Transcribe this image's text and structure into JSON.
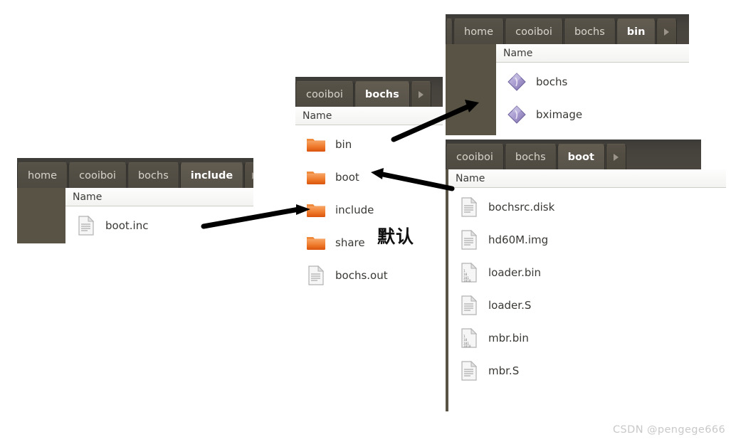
{
  "windows": [
    {
      "id": "include-window",
      "breadcrumbs": [
        {
          "label": "home",
          "active": false
        },
        {
          "label": "cooiboi",
          "active": false
        },
        {
          "label": "bochs",
          "active": false
        },
        {
          "label": "include",
          "active": true
        }
      ],
      "column_header": "Name",
      "items": [
        {
          "name": "boot.inc",
          "icon": "text-file-icon"
        }
      ]
    },
    {
      "id": "bochs-window",
      "leading_stub": true,
      "breadcrumbs": [
        {
          "label": "cooiboi",
          "active": false
        },
        {
          "label": "bochs",
          "active": true
        }
      ],
      "column_header": "Name",
      "items": [
        {
          "name": "bin",
          "icon": "folder-icon"
        },
        {
          "name": "boot",
          "icon": "folder-icon"
        },
        {
          "name": "include",
          "icon": "folder-icon"
        },
        {
          "name": "share",
          "icon": "folder-icon"
        },
        {
          "name": "bochs.out",
          "icon": "text-file-icon"
        }
      ]
    },
    {
      "id": "bin-window",
      "leading_stub": true,
      "breadcrumbs": [
        {
          "label": "home",
          "active": false
        },
        {
          "label": "cooiboi",
          "active": false
        },
        {
          "label": "bochs",
          "active": false
        },
        {
          "label": "bin",
          "active": true
        }
      ],
      "column_header": "Name",
      "items": [
        {
          "name": "bochs",
          "icon": "executable-icon"
        },
        {
          "name": "bximage",
          "icon": "executable-icon"
        }
      ]
    },
    {
      "id": "boot-window",
      "breadcrumbs": [
        {
          "label": "cooiboi",
          "active": false
        },
        {
          "label": "bochs",
          "active": false
        },
        {
          "label": "boot",
          "active": true
        }
      ],
      "column_header": "Name",
      "items": [
        {
          "name": "bochsrc.disk",
          "icon": "text-file-icon"
        },
        {
          "name": "hd60M.img",
          "icon": "text-file-icon"
        },
        {
          "name": "loader.bin",
          "icon": "binary-file-icon"
        },
        {
          "name": "loader.S",
          "icon": "text-file-icon"
        },
        {
          "name": "mbr.bin",
          "icon": "binary-file-icon"
        },
        {
          "name": "mbr.S",
          "icon": "text-file-icon"
        }
      ]
    }
  ],
  "annotations": {
    "default_note": "默认",
    "watermark": "CSDN @pengege666"
  },
  "colors": {
    "pathbar_dark": "#46433d",
    "crumb_active": "#625c50",
    "sidebar": "#585344",
    "folder_orange": "#e8641c",
    "executable_purple": "#9b8fc4",
    "list_background": "#ffffff",
    "annotation_black": "#111111",
    "watermark_gray": "#c9c9c9"
  }
}
